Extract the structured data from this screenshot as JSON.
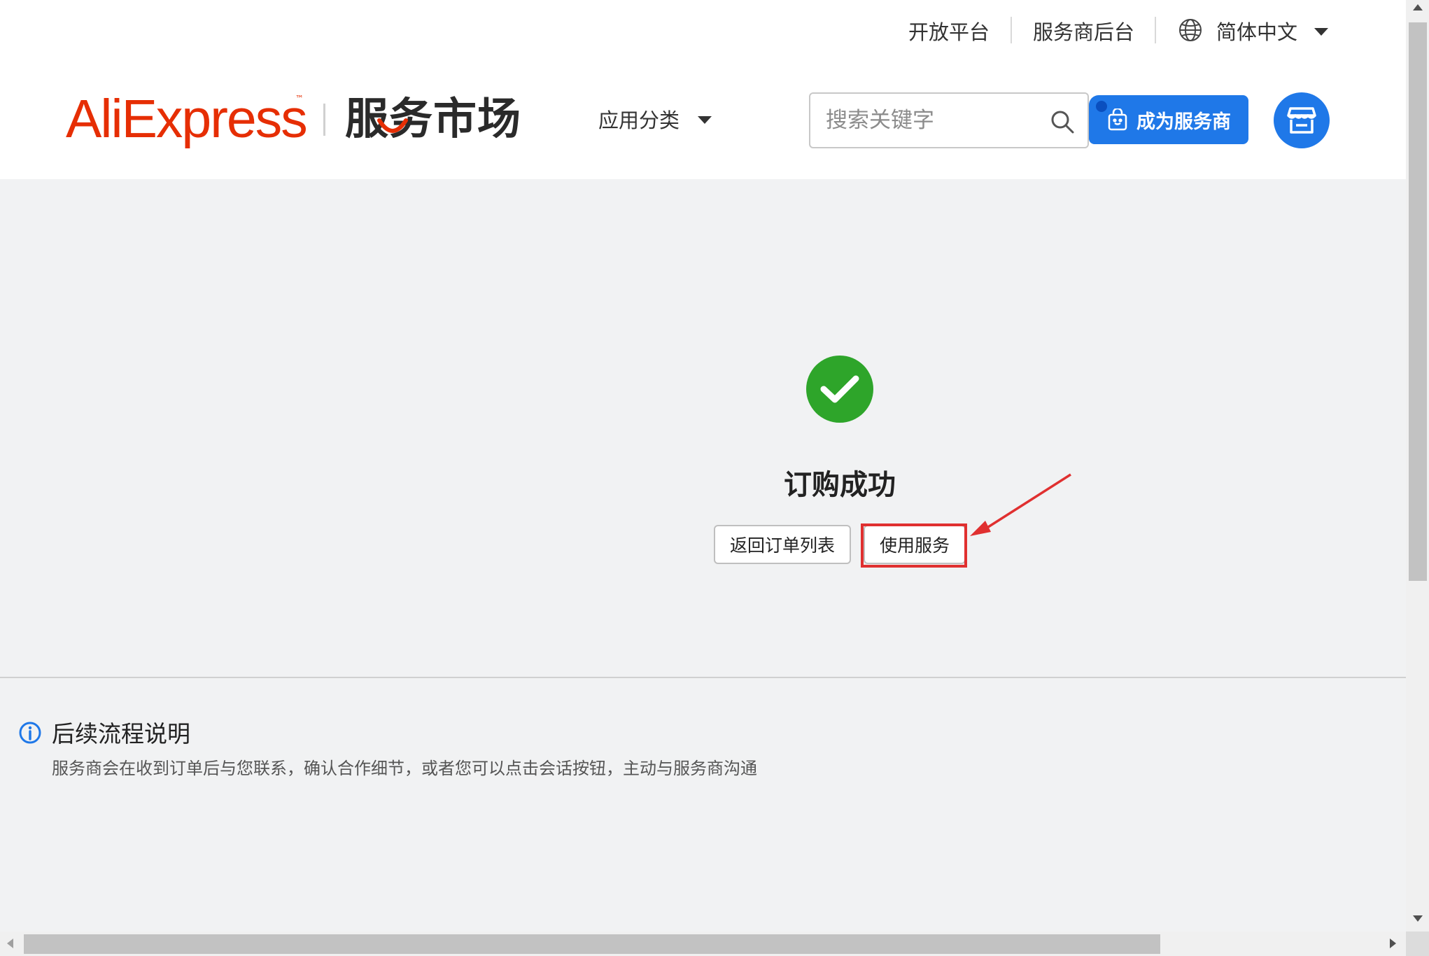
{
  "topbar": {
    "open_platform": "开放平台",
    "provider_backend": "服务商后台",
    "language": "简体中文"
  },
  "header": {
    "logo_text": "AliExpress",
    "logo_tm": "™",
    "logo_cn": "服务市场",
    "category_label": "应用分类",
    "search_placeholder": "搜索关键字",
    "become_provider": "成为服务商"
  },
  "result": {
    "title": "订购成功",
    "back_button": "返回订单列表",
    "use_button": "使用服务"
  },
  "info": {
    "title": "后续流程说明",
    "description": "服务商会在收到订单后与您联系，确认合作细节，或者您可以点击会话按钮，主动与服务商沟通"
  },
  "colors": {
    "brand_red": "#e62e04",
    "primary_blue": "#1f78e8",
    "success_green": "#2ea52a",
    "highlight_red": "#e03030"
  }
}
